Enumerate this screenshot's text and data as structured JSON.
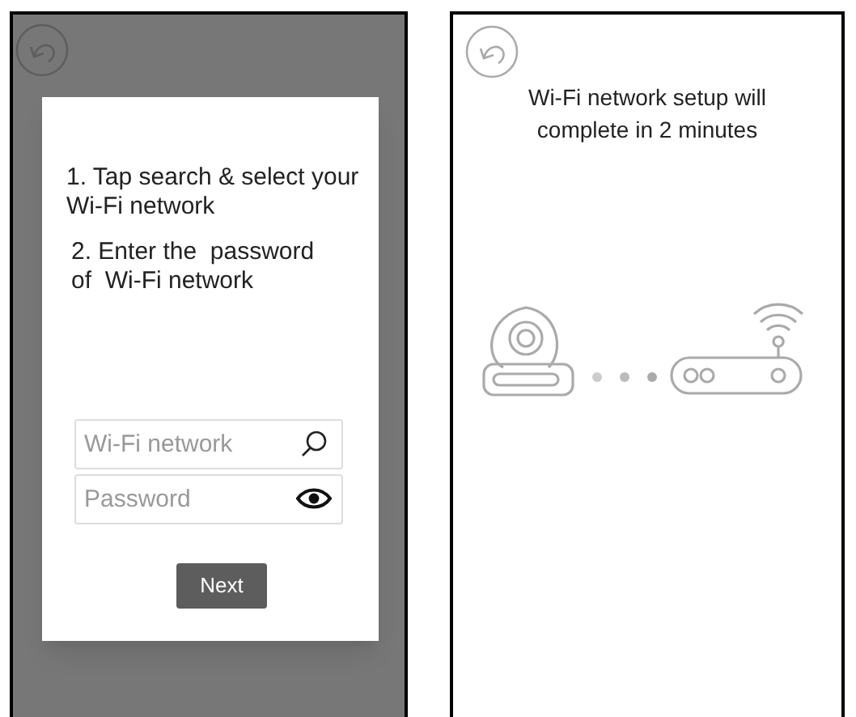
{
  "setup_dialog_screen": {
    "dialog": {
      "steps": [
        "1. Tap search & select your Wi-Fi network",
        "2. Enter the  password of  Wi-Fi network"
      ],
      "network_field": {
        "placeholder": "Wi-Fi network"
      },
      "password_field": {
        "placeholder": "Password"
      },
      "next_button": "Next"
    }
  },
  "progress_screen": {
    "message": "Wi-Fi network setup will complete in 2 minutes"
  }
}
